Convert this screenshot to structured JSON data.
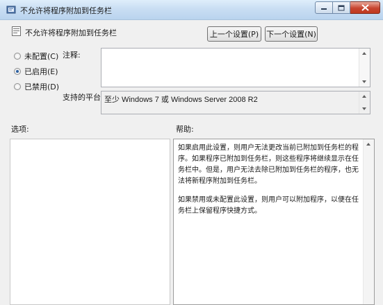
{
  "window": {
    "title": "不允许将程序附加到任务栏",
    "icons": {
      "app": "policy-editor-icon",
      "minimize": "minimize-icon",
      "maximize": "maximize-icon",
      "close": "close-icon"
    }
  },
  "policy": {
    "name": "不允许将程序附加到任务栏",
    "icon": "policy-setting-icon"
  },
  "nav": {
    "previous_label": "上一个设置(P)",
    "next_label": "下一个设置(N)"
  },
  "state": {
    "options": [
      {
        "label": "未配置(C)",
        "selected": false
      },
      {
        "label": "已启用(E)",
        "selected": true
      },
      {
        "label": "已禁用(D)",
        "selected": false
      }
    ]
  },
  "comment": {
    "label": "注释:",
    "value": ""
  },
  "supported": {
    "label": "支持的平台:",
    "value": "至少 Windows 7 或 Windows Server 2008 R2"
  },
  "options_section": {
    "label": "选项:"
  },
  "help_section": {
    "label": "帮助:",
    "paragraphs": [
      "如果启用此设置，则用户无法更改当前已附加到任务栏的程序。如果程序已附加到任务栏，则这些程序将继续显示在任务栏中。但是，用户无法去除已附加到任务栏的程序，也无法将新程序附加到任务栏。",
      "如果禁用或未配置此设置，则用户可以附加程序，以便在任务栏上保留程序快捷方式。"
    ]
  },
  "colors": {
    "titlebar": "#c9def3",
    "close_button": "#c7452f",
    "dialog_bg": "#f0f0f0"
  }
}
